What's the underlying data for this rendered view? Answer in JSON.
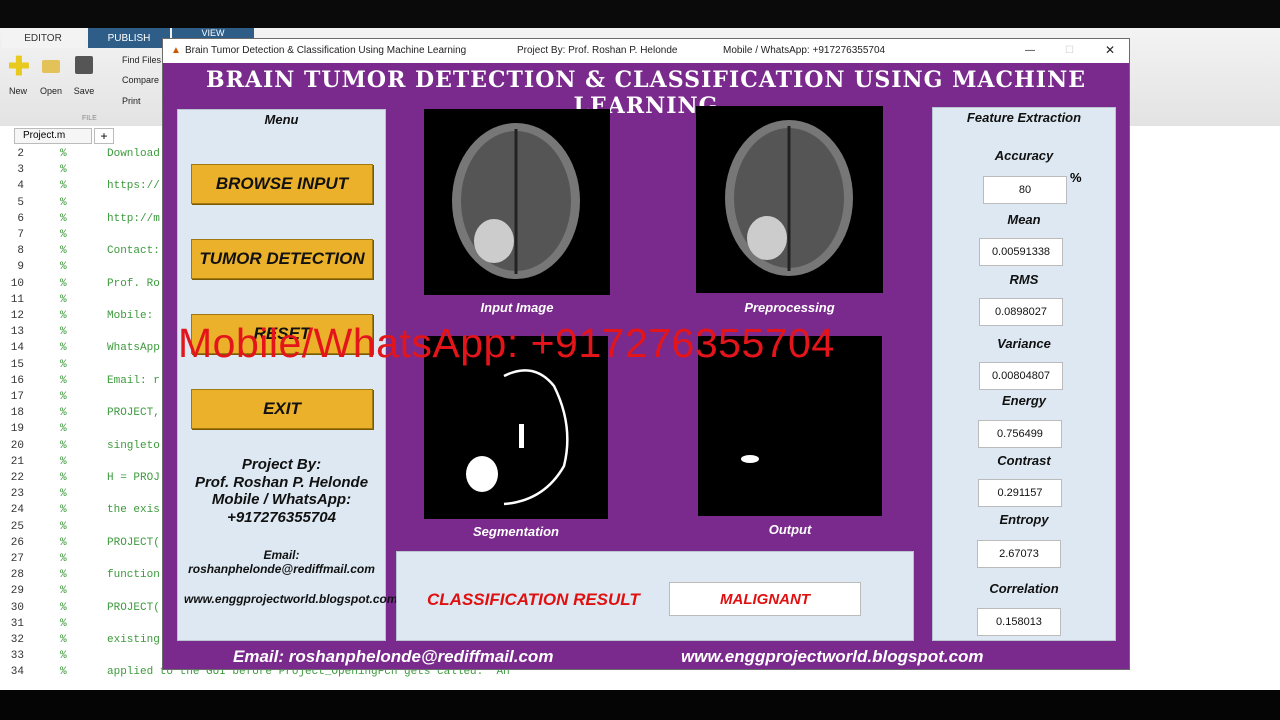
{
  "ribbon": {
    "tabs": [
      "EDITOR",
      "PUBLISH",
      "VIEW"
    ],
    "new": "New",
    "open": "Open",
    "save": "Save",
    "find_files": "Find Files",
    "compare": "Compare",
    "print": "Print",
    "section": "FILE",
    "file_tab": "Project.m",
    "add_tab": "+"
  },
  "editor": {
    "lines": [
      {
        "n": "2",
        "t": "Download"
      },
      {
        "n": "3",
        "t": ""
      },
      {
        "n": "4",
        "t": "https://"
      },
      {
        "n": "5",
        "t": ""
      },
      {
        "n": "6",
        "t": "http://m"
      },
      {
        "n": "7",
        "t": ""
      },
      {
        "n": "8",
        "t": "Contact:"
      },
      {
        "n": "9",
        "t": ""
      },
      {
        "n": "10",
        "t": "Prof. Ro"
      },
      {
        "n": "11",
        "t": ""
      },
      {
        "n": "12",
        "t": "Mobile:"
      },
      {
        "n": "13",
        "t": ""
      },
      {
        "n": "14",
        "t": "WhatsApp"
      },
      {
        "n": "15",
        "t": ""
      },
      {
        "n": "16",
        "t": "Email: r"
      },
      {
        "n": "17",
        "t": ""
      },
      {
        "n": "18",
        "t": "PROJECT,"
      },
      {
        "n": "19",
        "t": ""
      },
      {
        "n": "20",
        "t": "singleto"
      },
      {
        "n": "21",
        "t": ""
      },
      {
        "n": "22",
        "t": "H = PROJ"
      },
      {
        "n": "23",
        "t": ""
      },
      {
        "n": "24",
        "t": "the exis"
      },
      {
        "n": "25",
        "t": ""
      },
      {
        "n": "26",
        "t": "PROJECT("
      },
      {
        "n": "27",
        "t": ""
      },
      {
        "n": "28",
        "t": "function"
      },
      {
        "n": "29",
        "t": ""
      },
      {
        "n": "30",
        "t": "PROJECT("
      },
      {
        "n": "31",
        "t": ""
      },
      {
        "n": "32",
        "t": "existing"
      },
      {
        "n": "33",
        "t": ""
      },
      {
        "n": "34",
        "t": "applied to the GUI before Project_OpeningFcn gets called.  An"
      }
    ],
    "comment": "%"
  },
  "window": {
    "title": "Brain Tumor Detection & Classification Using Machine Learning",
    "project_by": "Project By:  Prof. Roshan P. Helonde",
    "mobile": "Mobile / WhatsApp: +917276355704",
    "minimize": "—",
    "maximize": "☐",
    "close": "✕"
  },
  "app": {
    "header": "BRAIN TUMOR DETECTION & CLASSIFICATION USING MACHINE LEARNING",
    "menu": {
      "title": "Menu",
      "buttons": [
        "BROWSE INPUT",
        "TUMOR DETECTION",
        "RESET",
        "EXIT"
      ],
      "project_by": "Project By:",
      "name": "Prof. Roshan P. Helonde",
      "mobile_label": "Mobile / WhatsApp:",
      "mobile": "+917276355704",
      "email_label": "Email:",
      "email": "roshanphelonde@rediffmail.com",
      "website": "www.enggprojectworld.blogspot.com"
    },
    "images": {
      "input": "Input Image",
      "preprocessing": "Preprocessing",
      "segmentation": "Segmentation",
      "output": "Output"
    },
    "classification": {
      "label": "CLASSIFICATION RESULT",
      "value": "MALIGNANT"
    },
    "features": {
      "title": "Feature Extraction",
      "accuracy_unit": "%",
      "items": [
        {
          "label": "Accuracy",
          "value": "80"
        },
        {
          "label": "Mean",
          "value": "0.00591338"
        },
        {
          "label": "RMS",
          "value": "0.0898027"
        },
        {
          "label": "Variance",
          "value": "0.00804807"
        },
        {
          "label": "Energy",
          "value": "0.756499"
        },
        {
          "label": "Contrast",
          "value": "0.291157"
        },
        {
          "label": "Entropy",
          "value": "2.67073"
        },
        {
          "label": "Correlation",
          "value": "0.158013"
        }
      ]
    },
    "footer": {
      "email": "Email: roshanphelonde@rediffmail.com",
      "website": "www.enggprojectworld.blogspot.com"
    }
  },
  "watermark": "Mobile/WhatsApp: +917276355704"
}
